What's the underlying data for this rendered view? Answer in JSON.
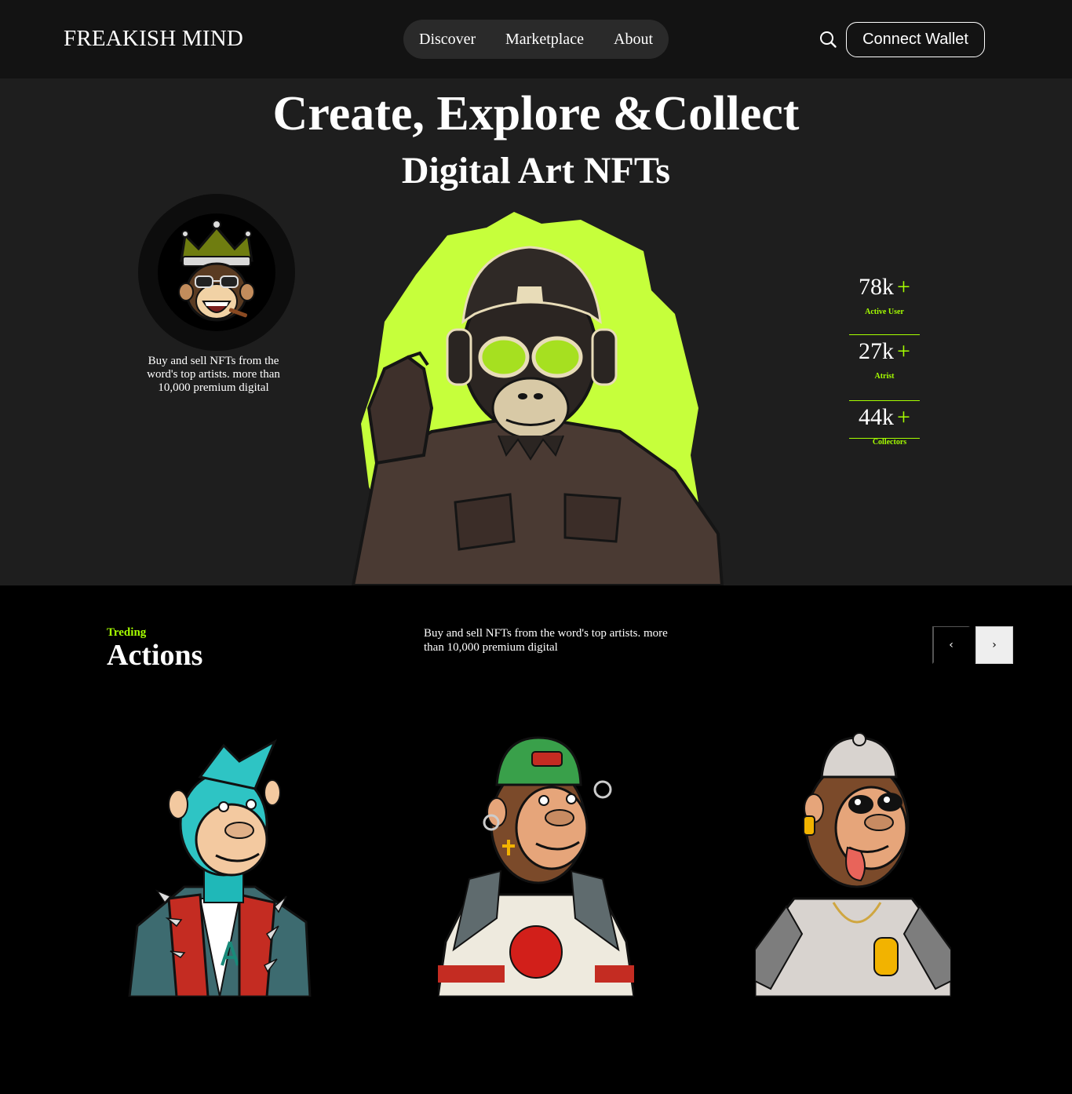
{
  "header": {
    "logo": "FREAKISH MIND",
    "nav": [
      "Discover",
      "Marketplace",
      "About"
    ],
    "search_icon": "search-icon",
    "wallet_label": "Connect Wallet"
  },
  "hero": {
    "title_line1": "Create, Explore &Collect",
    "title_line2": "Digital Art NFTs",
    "description": "Buy and sell NFTs from the word's top artists. more than 10,000 premium digital",
    "stats": [
      {
        "value": "78k",
        "plus": "+",
        "label": "Active User"
      },
      {
        "value": "27k",
        "plus": "+",
        "label": "Atrist"
      },
      {
        "value": "44k",
        "plus": "+",
        "label": "Collectors"
      }
    ]
  },
  "trending": {
    "kicker": "Treding",
    "title": "Actions",
    "description": "Buy and sell NFTs from the word's top artists. more than 10,000 premium digital",
    "prev_icon": "‹",
    "next_icon": "›"
  },
  "colors": {
    "accent": "#a6ff00",
    "header_bg": "#131313",
    "hero_bg": "#1e1e1e",
    "page_bg": "#000000"
  }
}
